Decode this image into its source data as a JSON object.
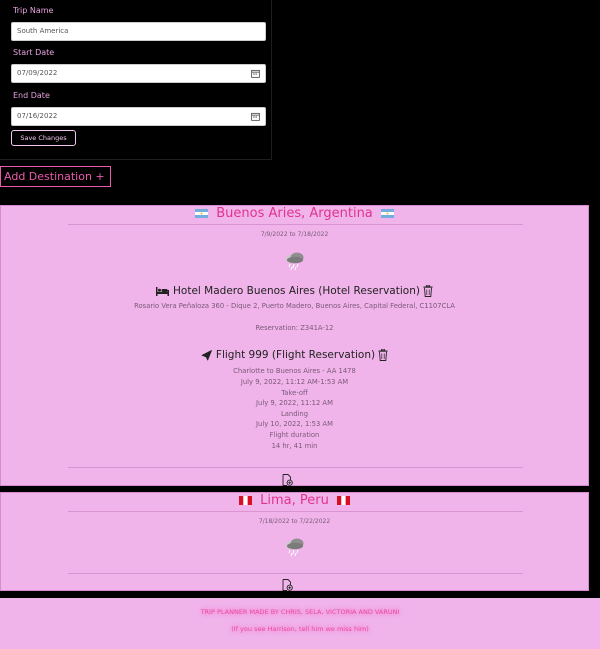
{
  "form": {
    "trip_name_label": "Trip Name",
    "trip_name_value": "South America",
    "start_date_label": "Start Date",
    "start_date_value": "07/09/2022",
    "end_date_label": "End Date",
    "end_date_value": "07/16/2022",
    "save_label": "Save Changes"
  },
  "add_destination_label": "Add Destination +",
  "destinations": [
    {
      "flag": "argentina",
      "title": "Buenos Aries, Argentina",
      "dates": "7/9/2022 to 7/18/2022",
      "weather_icon": "rain-cloud-icon",
      "hotel": {
        "title": "Hotel Madero Buenos Aires (Hotel Reservation)",
        "address": "Rosario Vera Peñaloza 360 - Dique 2, Puerto Madero, Buenos Aires, Capital Federal, C1107CLA",
        "reservation": "Reservation: Z341A-12"
      },
      "flight": {
        "title": "Flight 999 (Flight Reservation)",
        "route": "Charlotte to Buenos Aires - AA 1478",
        "times": "July 9, 2022, 11:12 AM-1:53 AM",
        "takeoff_label": "Take-off",
        "takeoff_time": "July 9, 2022, 11:12 AM",
        "landing_label": "Landing",
        "landing_time": "July 10, 2022, 1:53 AM",
        "duration_label": "Flight duration",
        "duration": "14 hr, 41 min"
      }
    },
    {
      "flag": "peru",
      "title": "Lima, Peru",
      "dates": "7/18/2022 to 7/22/2022",
      "weather_icon": "rain-cloud-icon"
    }
  ],
  "footer": {
    "credits": "TRIP PLANNER MADE BY CHRIS, SELA, VICTORIA AND VARUNI",
    "note": "(If you see Harrison, tell him we miss him)"
  },
  "colors": {
    "accent_pink": "#ec5aad",
    "card_bg": "#f0b4ea",
    "title_pink": "#e0338f"
  }
}
